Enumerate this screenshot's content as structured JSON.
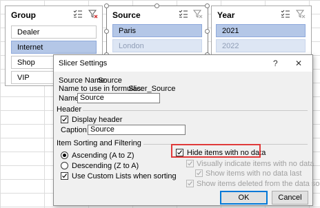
{
  "slicers": {
    "group": {
      "header": "Group",
      "items": [
        "Dealer",
        "Internet",
        "Shop",
        "VIP"
      ],
      "multi_select_icon": "multi-select-icon",
      "clear_filter_icon": "clear-filter-icon"
    },
    "source": {
      "header": "Source",
      "items": [
        "Paris",
        "London"
      ],
      "multi_select_icon": "multi-select-icon",
      "clear_filter_icon": "clear-filter-icon"
    },
    "year": {
      "header": "Year",
      "items": [
        "2021",
        "2022"
      ],
      "multi_select_icon": "multi-select-icon",
      "clear_filter_icon": "clear-filter-icon"
    }
  },
  "dialog": {
    "title": "Slicer Settings",
    "help_glyph": "?",
    "close_glyph": "✕",
    "source_name_label": "Source Name:",
    "source_name_value": "Source",
    "formula_name_label": "Name to use in formulas:",
    "formula_name_value": "Slicer_Source",
    "name_label": "Name:",
    "name_value": "Source",
    "header_section": "Header",
    "display_header_label": "Display header",
    "display_header_checked": true,
    "caption_label": "Caption:",
    "caption_value": "Source",
    "sorting_section": "Item Sorting and Filtering",
    "ascending_label": "Ascending (A to Z)",
    "descending_label": "Descending (Z to A)",
    "sort_order": "ascending",
    "custom_lists_label": "Use Custom Lists when sorting",
    "custom_lists_checked": true,
    "hide_items_label": "Hide items with no data",
    "hide_items_checked": true,
    "visually_indicate_label": "Visually indicate items with no data",
    "show_last_label": "Show items with no data last",
    "show_deleted_label": "Show items deleted from the data source",
    "ok_label": "OK",
    "cancel_label": "Cancel"
  },
  "colors": {
    "selected_item": "#b4c7e7",
    "nodata_item": "#dde6f4",
    "highlight": "#e03a3a"
  }
}
